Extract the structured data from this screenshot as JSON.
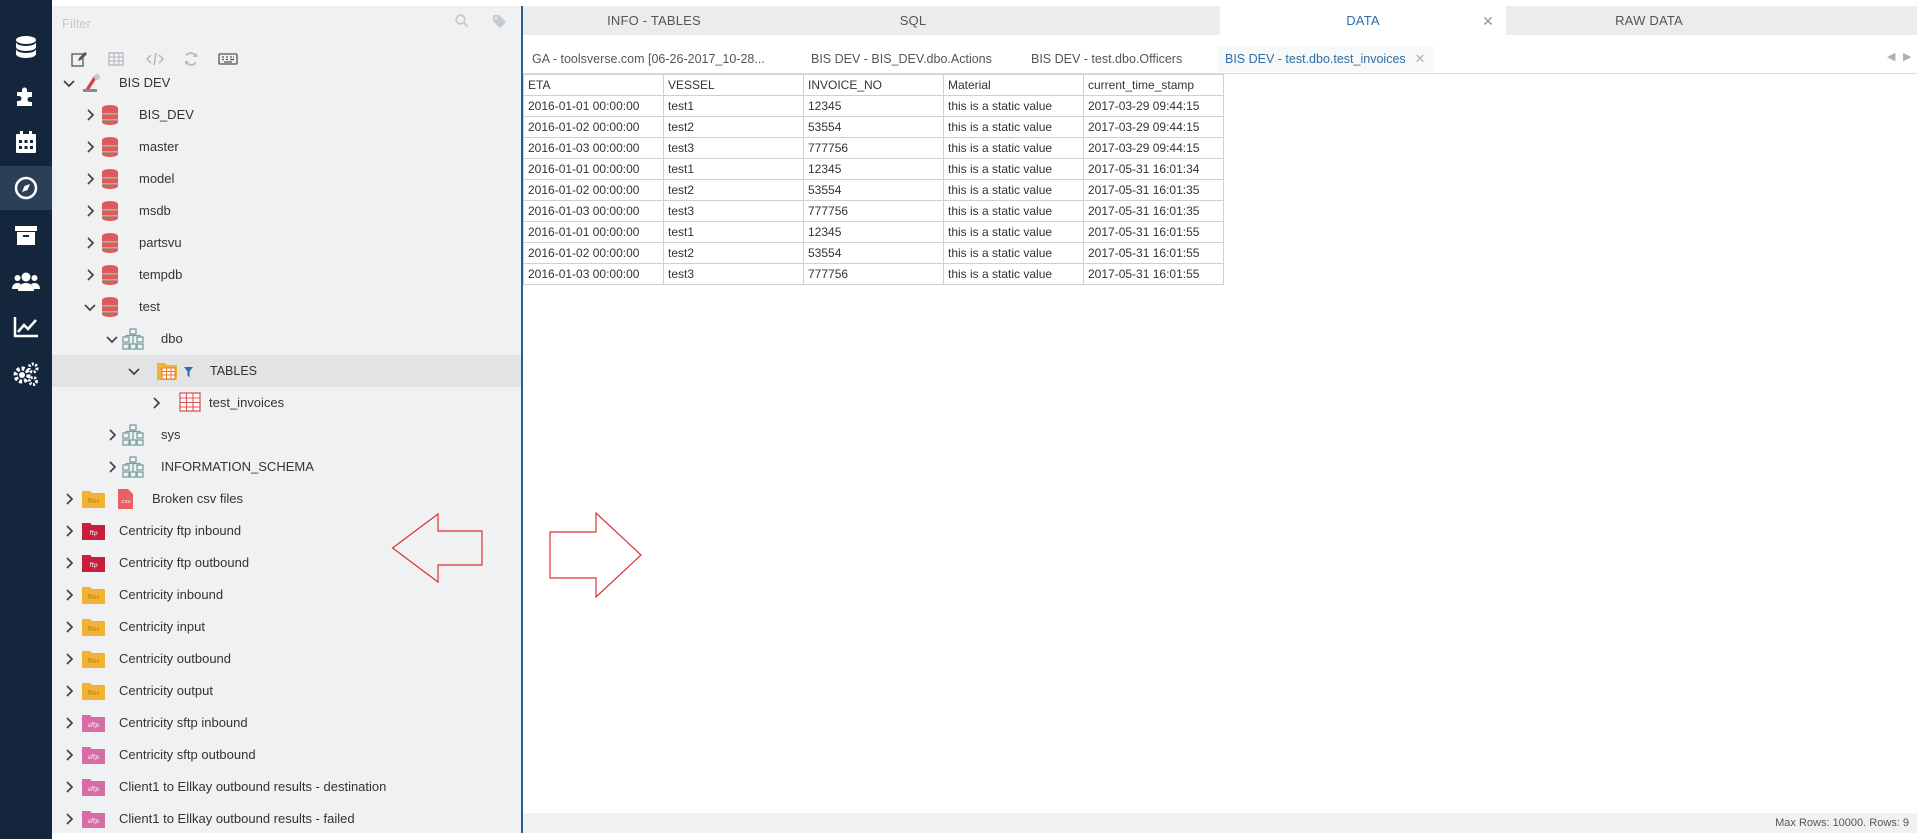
{
  "filter": {
    "placeholder": "Filter"
  },
  "icons": {
    "sidebar": [
      "database-icon",
      "puzzle-icon",
      "calendar-icon",
      "compass-icon",
      "archive-icon",
      "users-icon",
      "chart-line-icon",
      "cogs-icon"
    ]
  },
  "tree": {
    "connection": "BIS DEV",
    "databases": [
      "BIS_DEV",
      "master",
      "model",
      "msdb",
      "partsvu",
      "tempdb",
      "test"
    ],
    "schema": "dbo",
    "tables_node": "TABLES",
    "table": "test_invoices",
    "other_schemas": [
      "sys",
      "INFORMATION_SCHEMA"
    ],
    "folders": [
      {
        "label": "Broken csv files",
        "badge": "csv"
      },
      {
        "label": "Centricity ftp inbound",
        "badge": "ftp"
      },
      {
        "label": "Centricity ftp outbound",
        "badge": "ftp"
      },
      {
        "label": "Centricity inbound",
        "badge": "files"
      },
      {
        "label": "Centricity input",
        "badge": "files"
      },
      {
        "label": "Centricity outbound",
        "badge": "files"
      },
      {
        "label": "Centricity output",
        "badge": "files"
      },
      {
        "label": "Centricity sftp inbound",
        "badge": "sftp"
      },
      {
        "label": "Centricity sftp outbound",
        "badge": "sftp"
      },
      {
        "label": "Client1 to Ellkay outbound results - destination",
        "badge": "sftp"
      },
      {
        "label": "Client1 to Ellkay outbound results - failed",
        "badge": "sftp"
      }
    ]
  },
  "top_tabs": [
    "INFO - TABLES",
    "SQL",
    "DATA",
    "RAW DATA"
  ],
  "doc_tabs": [
    "GA - toolsverse.com [06-26-2017_10-28...",
    "BIS DEV - BIS_DEV.dbo.Actions",
    "BIS DEV - test.dbo.Officers",
    "BIS DEV - test.dbo.test_invoices"
  ],
  "grid": {
    "columns": [
      "ETA",
      "VESSEL",
      "INVOICE_NO",
      "Material",
      "current_time_stamp"
    ],
    "rows": [
      [
        "2016-01-01 00:00:00",
        "test1",
        "12345",
        "this is a static value",
        "2017-03-29 09:44:15"
      ],
      [
        "2016-01-02 00:00:00",
        "test2",
        "53554",
        "this is a static value",
        "2017-03-29 09:44:15"
      ],
      [
        "2016-01-03 00:00:00",
        "test3",
        "777756",
        "this is a static value",
        "2017-03-29 09:44:15"
      ],
      [
        "2016-01-01 00:00:00",
        "test1",
        "12345",
        "this is a static value",
        "2017-05-31 16:01:34"
      ],
      [
        "2016-01-02 00:00:00",
        "test2",
        "53554",
        "this is a static value",
        "2017-05-31 16:01:35"
      ],
      [
        "2016-01-03 00:00:00",
        "test3",
        "777756",
        "this is a static value",
        "2017-05-31 16:01:35"
      ],
      [
        "2016-01-01 00:00:00",
        "test1",
        "12345",
        "this is a static value",
        "2017-05-31 16:01:55"
      ],
      [
        "2016-01-02 00:00:00",
        "test2",
        "53554",
        "this is a static value",
        "2017-05-31 16:01:55"
      ],
      [
        "2016-01-03 00:00:00",
        "test3",
        "777756",
        "this is a static value",
        "2017-05-31 16:01:55"
      ]
    ]
  },
  "status": "Max Rows: 10000. Rows: 9",
  "colors": {
    "sidebar": "#13263b",
    "accent": "#2f6ea6",
    "arrow": "#e03030",
    "panel": "#f0f1f2"
  }
}
